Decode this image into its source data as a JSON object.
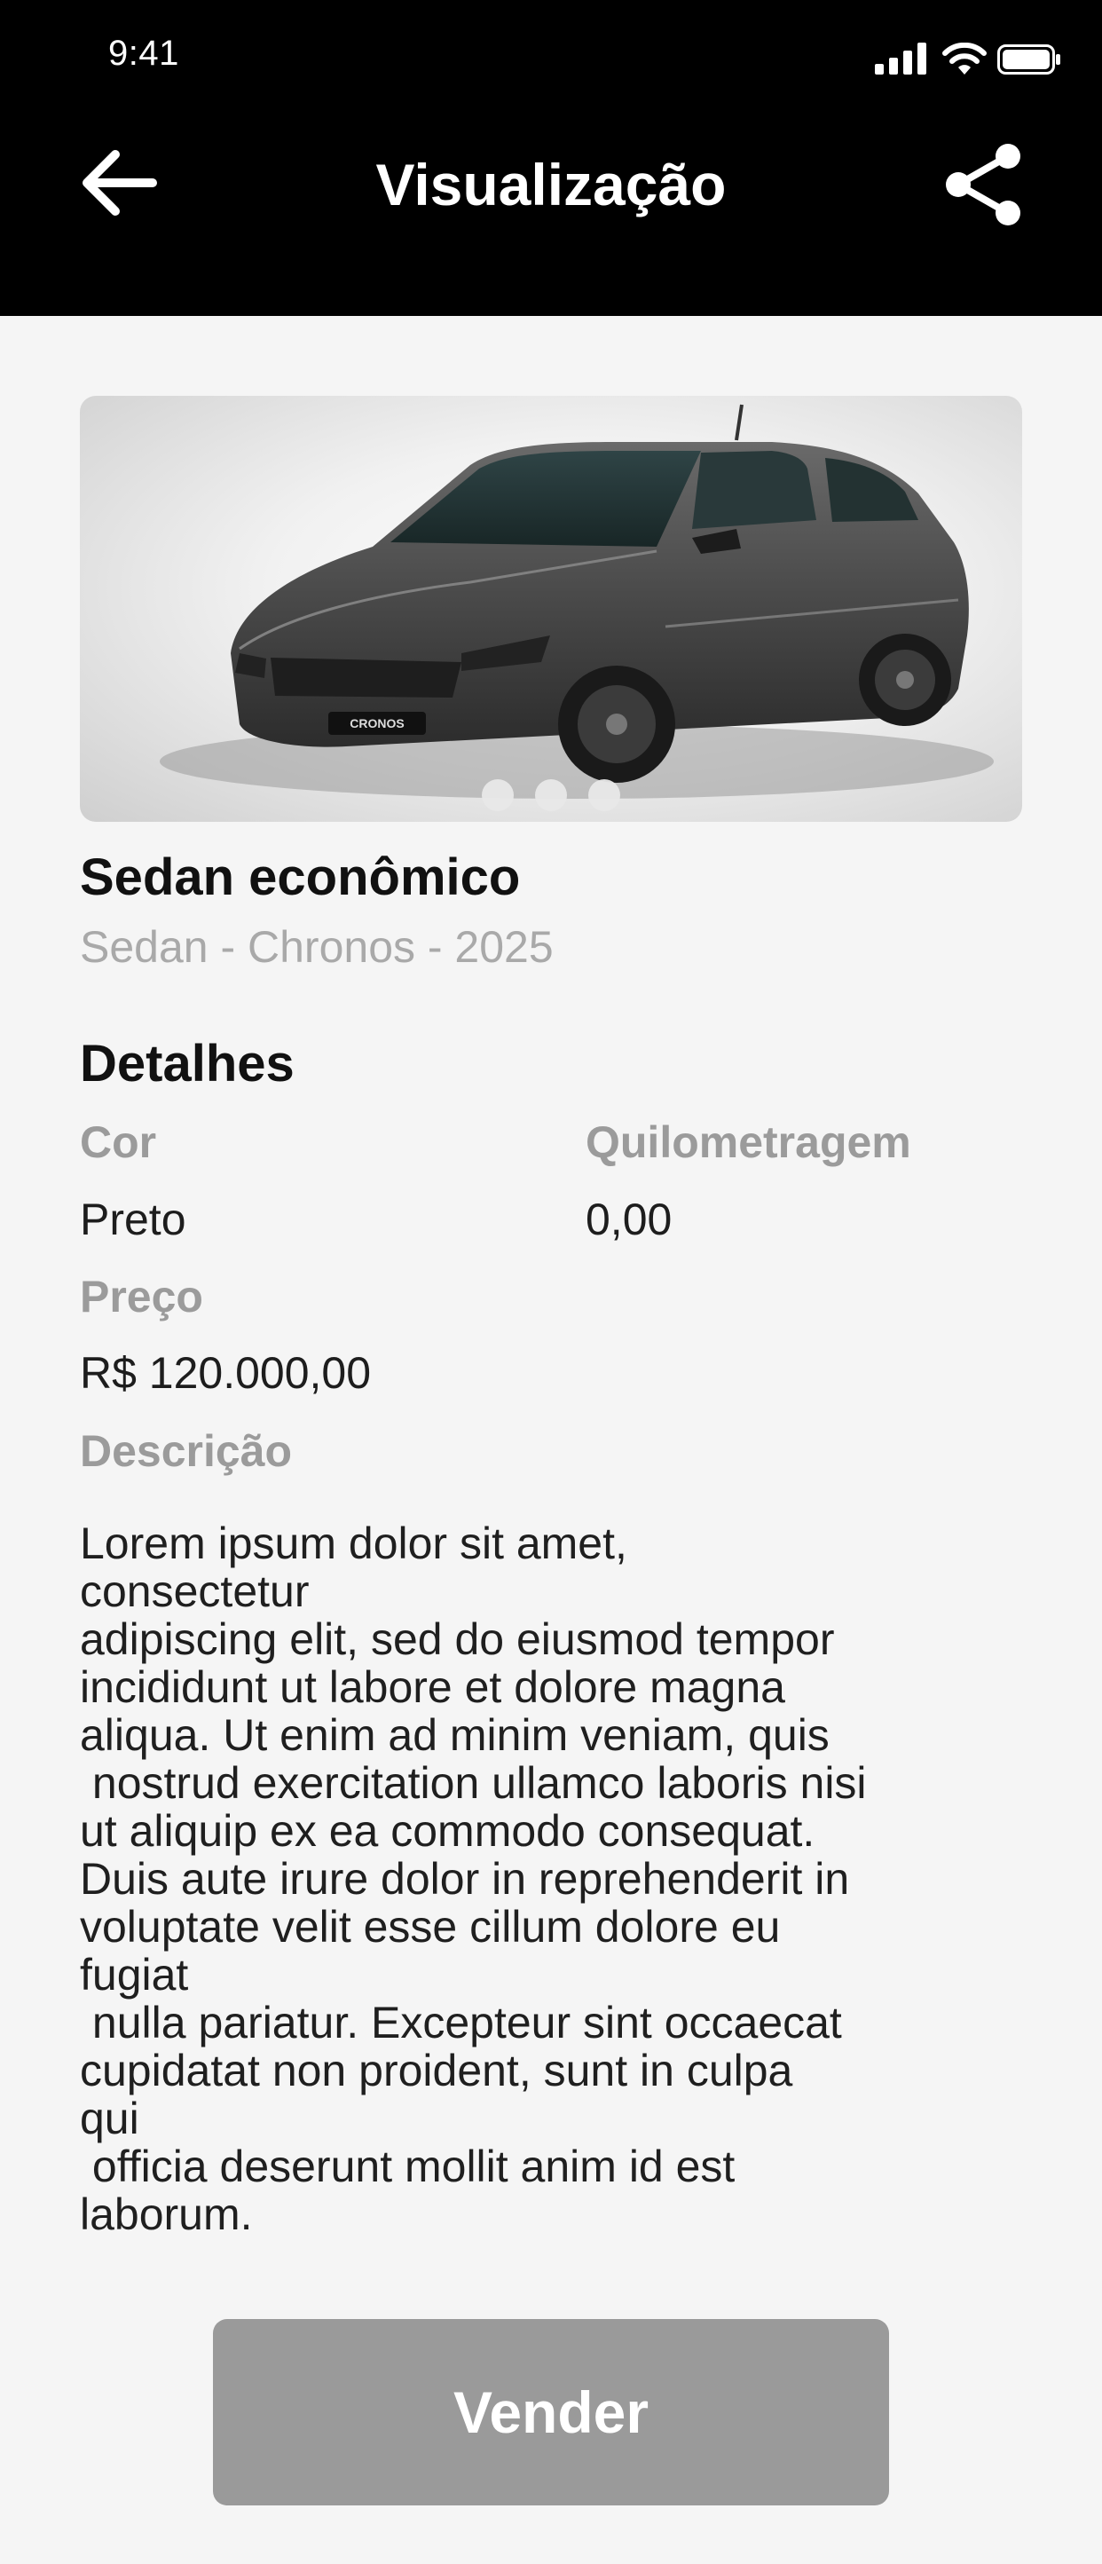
{
  "status_bar": {
    "time": "9:41",
    "icons": [
      "signal-icon",
      "wifi-icon",
      "battery-icon"
    ]
  },
  "header": {
    "title": "Visualização",
    "back_icon": "arrow-left-icon",
    "share_icon": "share-icon"
  },
  "listing": {
    "image_alt": "Sedan Fiat Cronos",
    "image_plate_text": "CRONOS",
    "image_dots": 3,
    "title": "Sedan econômico",
    "subtitle": "Sedan - Chronos - 2025"
  },
  "details": {
    "section_title": "Detalhes",
    "color_label": "Cor",
    "color_value": "Preto",
    "mileage_label": "Quilometragem",
    "mileage_value": "0,00",
    "price_label": "Preço",
    "price_value": "R$ 120.000,00",
    "description_label": "Descrição",
    "description_text": "Lorem ipsum dolor sit amet,\nconsectetur\nadipiscing elit, sed do eiusmod tempor\nincididunt ut labore et dolore magna\naliqua. Ut enim ad minim veniam, quis\n nostrud exercitation ullamco laboris nisi\nut aliquip ex ea commodo consequat.\nDuis aute irure dolor in reprehenderit in\nvoluptate velit esse cillum dolore eu\nfugiat\n nulla pariatur. Excepteur sint occaecat\ncupidatat non proident, sunt in culpa\nqui\n officia deserunt mollit anim id est\nlaborum."
  },
  "actions": {
    "sell_label": "Vender"
  },
  "colors": {
    "header_bg": "#000000",
    "page_bg": "#f5f5f5",
    "label_gray": "#9b9b9b",
    "subtitle_gray": "#a9a9a9",
    "button_bg": "#9a9a9a"
  }
}
